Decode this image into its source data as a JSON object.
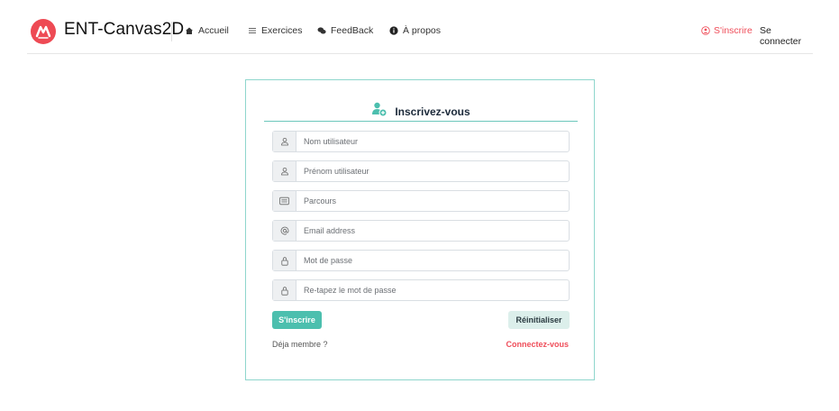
{
  "brand": {
    "name": "ENT-Canvas2D",
    "accent": "#ee4a54"
  },
  "nav": {
    "items": [
      {
        "label": "Accueil",
        "icon": "home-icon"
      },
      {
        "label": "Exercices",
        "icon": "list-icon"
      },
      {
        "label": "FeedBack",
        "icon": "comments-icon"
      },
      {
        "label": "À propos",
        "icon": "info-icon"
      }
    ],
    "signup": {
      "label": "S'inscrire",
      "icon": "user-circle-icon",
      "color": "#ef4e5a"
    },
    "login": {
      "label": "Se connecter"
    }
  },
  "form": {
    "title": "Inscrivez-vous",
    "title_icon": "user-plus-icon",
    "fields": [
      {
        "placeholder": "Nom utilisateur",
        "icon": "user-icon"
      },
      {
        "placeholder": "Prénom utilisateur",
        "icon": "user-icon"
      },
      {
        "placeholder": "Parcours",
        "icon": "card-icon"
      },
      {
        "placeholder": "Email address",
        "icon": "at-icon"
      },
      {
        "placeholder": "Mot de passe",
        "icon": "lock-icon"
      },
      {
        "placeholder": "Re-tapez le mot de passe",
        "icon": "lock-icon"
      }
    ],
    "submit_label": "S'inscrire",
    "reset_label": "Réinitialiser",
    "member_text": "Déja membre ?",
    "connect_label": "Connectez-vous",
    "primary_color": "#4cbfae",
    "border_color": "#8fd6cd"
  }
}
